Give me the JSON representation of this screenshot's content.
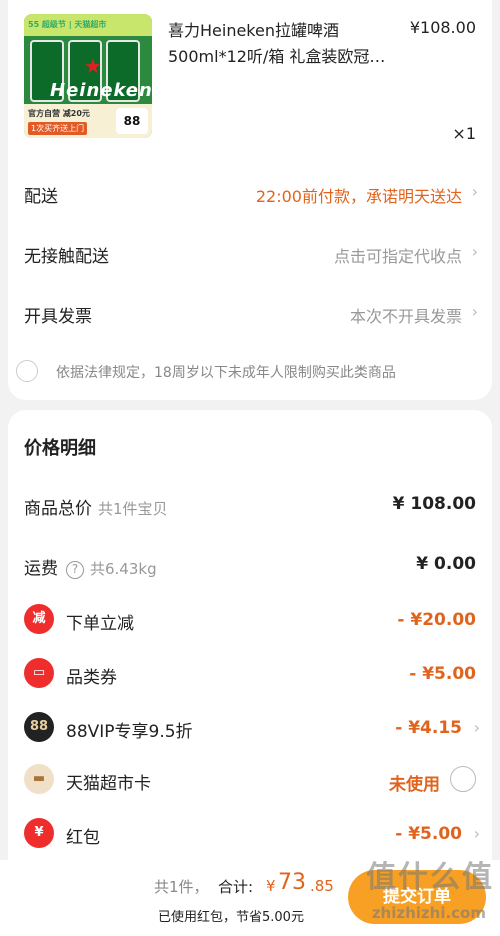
{
  "product": {
    "name": "喜力Heineken拉罐啤酒500ml*12听/箱 礼盒装欧冠…",
    "price": "¥108.00",
    "quantity": "×1",
    "thumb_top_text": "55 超级节 | 天猫超市",
    "thumb_brand": "Heineken",
    "thumb_promo_line1": "官方自营 减20元",
    "thumb_promo_line2": "1次买齐送上门",
    "thumb_badge": "88"
  },
  "rows": {
    "delivery": {
      "label": "配送",
      "value": "22:00前付款，承诺明天送达"
    },
    "contactless": {
      "label": "无接触配送",
      "value": "点击可指定代收点"
    },
    "invoice": {
      "label": "开具发票",
      "value": "本次不开具发票"
    },
    "notice": "依据法律规定，18周岁以下未成年人限制购买此类商品"
  },
  "price_detail": {
    "title": "价格明细",
    "goods_total": {
      "label": "商品总价",
      "sub": "共1件宝贝",
      "amount": "¥ 108.00"
    },
    "shipping": {
      "label": "运费",
      "sub": "共6.43kg",
      "amount": "¥ 0.00"
    },
    "order_discount": {
      "icon": "减",
      "label": "下单立减",
      "amount": "- ¥20.00"
    },
    "category_coupon": {
      "label": "品类券",
      "amount": "- ¥5.00"
    },
    "vip": {
      "icon": "88",
      "label": "88VIP专享9.5折",
      "amount": "- ¥4.15"
    },
    "supermarket_card": {
      "label": "天猫超市卡",
      "status": "未使用"
    },
    "red_packet": {
      "icon": "¥",
      "label": "红包",
      "amount": "- ¥5.00"
    }
  },
  "bottom_bar": {
    "count": "共1件，",
    "total_label": "合计:",
    "currency": "¥",
    "total_int": "73",
    "total_dec": ".85",
    "saved": "已使用红包，节省5.00元",
    "submit": "提交订单",
    "watermark": "值什么值",
    "watermark_url": "zhizhizhi.com"
  },
  "colors": {
    "accent": "#e0641d",
    "submit": "#f7a024",
    "red": "#ef2d2d"
  }
}
